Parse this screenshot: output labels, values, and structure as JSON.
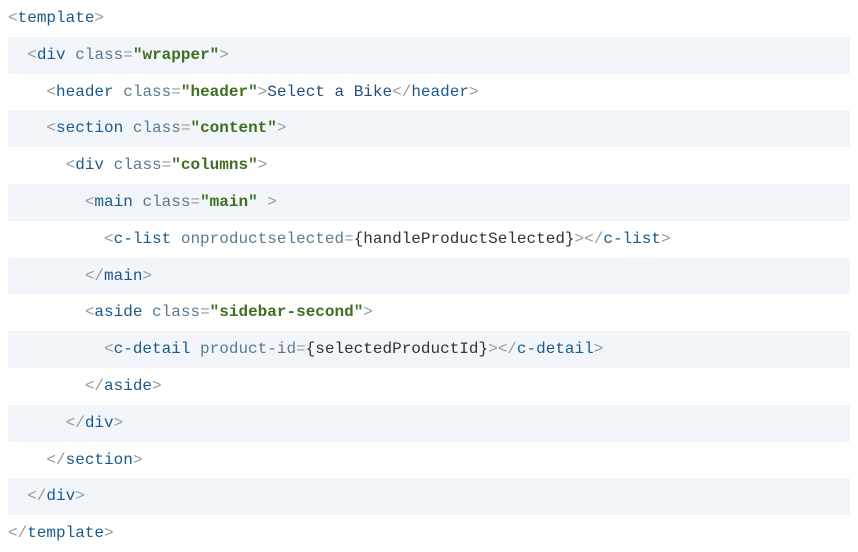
{
  "code": {
    "line1": {
      "t_open": "template"
    },
    "line2": {
      "t": "div",
      "a": "class",
      "v": "\"wrapper\""
    },
    "line3": {
      "t": "header",
      "a": "class",
      "v": "\"header\"",
      "text": "Select a Bike"
    },
    "line4": {
      "t": "section",
      "a": "class",
      "v": "\"content\""
    },
    "line5": {
      "t": "div",
      "a": "class",
      "v": "\"columns\""
    },
    "line6": {
      "t": "main",
      "a": "class",
      "v": "\"main\""
    },
    "line7": {
      "t": "c-list",
      "a": "onproductselected",
      "expr": "{handleProductSelected}"
    },
    "line8": {
      "t": "main"
    },
    "line9": {
      "t": "aside",
      "a": "class",
      "v": "\"sidebar-second\""
    },
    "line10": {
      "t": "c-detail",
      "a": "product-id",
      "expr": "{selectedProductId}"
    },
    "line11": {
      "t": "aside"
    },
    "line12": {
      "t": "div"
    },
    "line13": {
      "t": "section"
    },
    "line14": {
      "t": "div"
    },
    "line15": {
      "t": "template"
    }
  }
}
